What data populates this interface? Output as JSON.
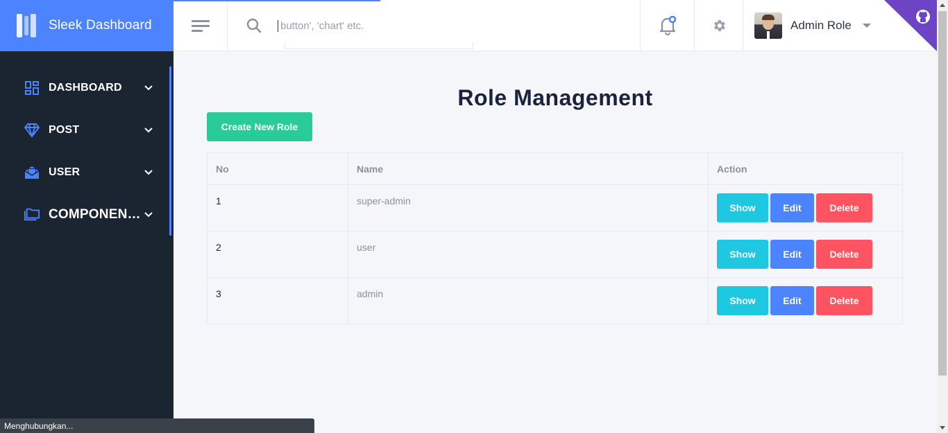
{
  "app": {
    "title": "Sleek Dashboard"
  },
  "sidebar": {
    "items": [
      {
        "label": "DASHBOARD",
        "icon": "dashboard-grid-icon"
      },
      {
        "label": "POST",
        "icon": "diamond-icon"
      },
      {
        "label": "USER",
        "icon": "envelope-open-icon"
      },
      {
        "label": "COMPONENTS",
        "icon": "folder-multiple-icon"
      }
    ]
  },
  "header": {
    "search_placeholder": "button', 'chart' etc.",
    "user_name": "Admin Role"
  },
  "main": {
    "title": "Role Management",
    "create_button": "Create New Role",
    "table": {
      "columns": [
        "No",
        "Name",
        "Action"
      ],
      "rows": [
        {
          "no": "1",
          "name": "super-admin"
        },
        {
          "no": "2",
          "name": "user"
        },
        {
          "no": "3",
          "name": "admin"
        }
      ],
      "actions": {
        "show": "Show",
        "edit": "Edit",
        "delete": "Delete"
      }
    }
  },
  "status_bar": {
    "text": "Menghubungkan..."
  },
  "colors": {
    "accent": "#4c84ff",
    "sidebar_bg": "#1b2431",
    "success": "#29cc97",
    "info": "#1ec8e0",
    "danger": "#fe5461"
  }
}
